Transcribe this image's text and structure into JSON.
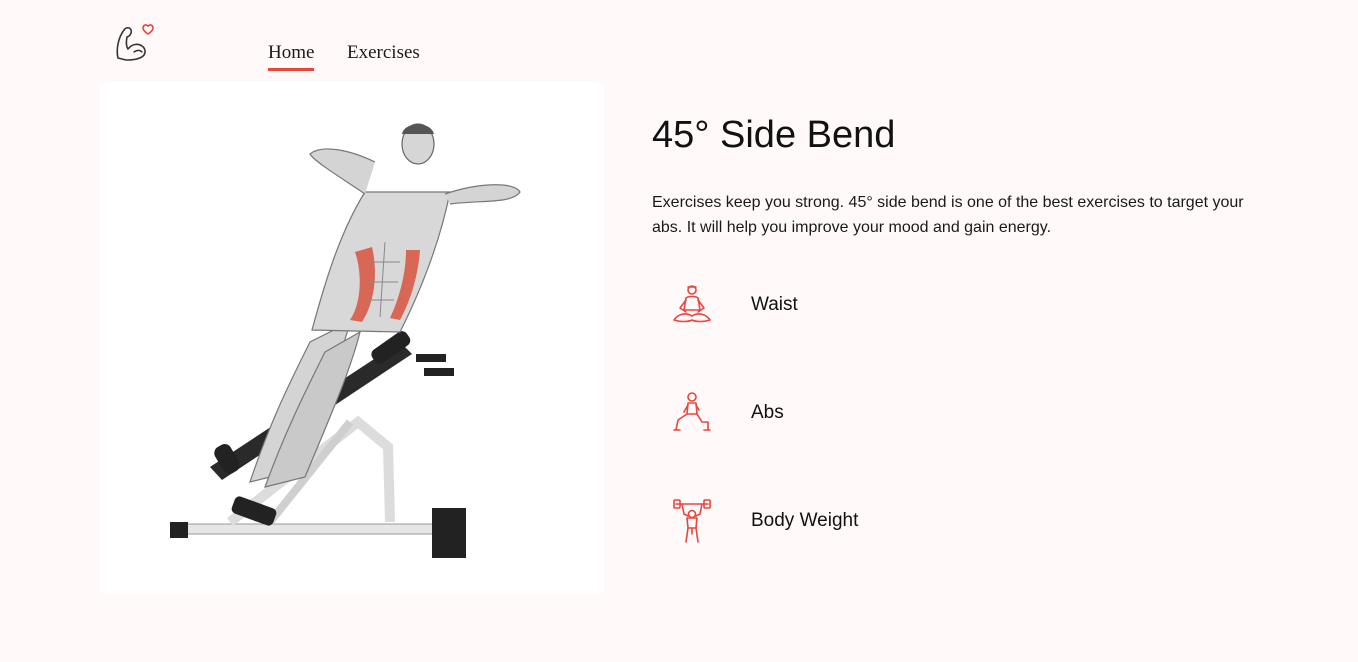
{
  "nav": {
    "logo_icon": "flexed-arm-heart-icon",
    "links": [
      {
        "label": "Home",
        "active": true
      },
      {
        "label": "Exercises",
        "active": false
      }
    ],
    "accent_color": "#e8463f"
  },
  "exercise": {
    "image_icon": "side-bend-exercise-illustration",
    "title": "45° Side Bend",
    "description": "Exercises keep you strong. 45° side bend is one of the best exercises to target your abs. It will help you improve your mood and gain energy.",
    "tags": [
      {
        "label": "Waist",
        "icon": "yoga-meditation-icon"
      },
      {
        "label": "Abs",
        "icon": "lunge-icon"
      },
      {
        "label": "Body Weight",
        "icon": "weightlifter-icon"
      }
    ]
  }
}
